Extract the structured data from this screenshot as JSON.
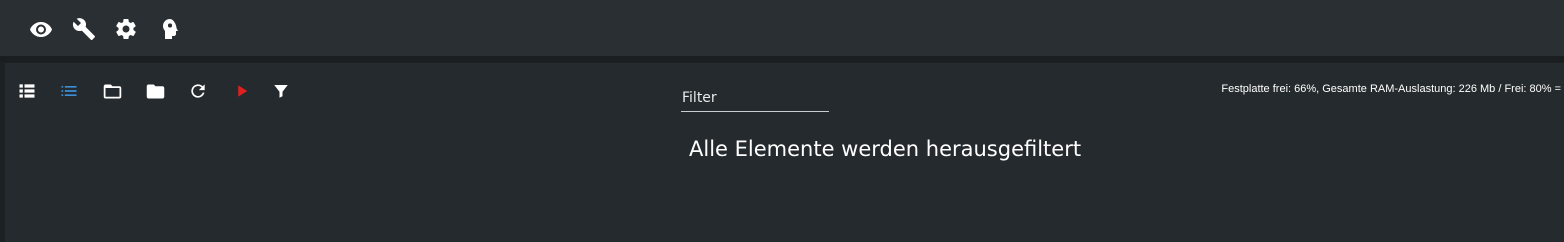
{
  "topbar": {
    "icons": [
      "eye-icon",
      "wrench-icon",
      "gear-icon",
      "head-profile-icon"
    ]
  },
  "toolbar": {
    "icons": [
      "list-table-icon",
      "list-lines-icon",
      "folder-outline-icon",
      "folder-filled-icon",
      "refresh-icon",
      "play-icon",
      "filter-icon"
    ],
    "colors": {
      "default": "#ffffff",
      "active": "#3b8fd6",
      "play": "#e02020"
    }
  },
  "filter": {
    "placeholder": "Filter",
    "value": ""
  },
  "status": {
    "text": "Festplatte frei: 66%, Gesamte RAM-Auslastung: 226 Mb / Frei: 80% ="
  },
  "main": {
    "empty_message": "Alle Elemente werden herausgefiltert"
  }
}
